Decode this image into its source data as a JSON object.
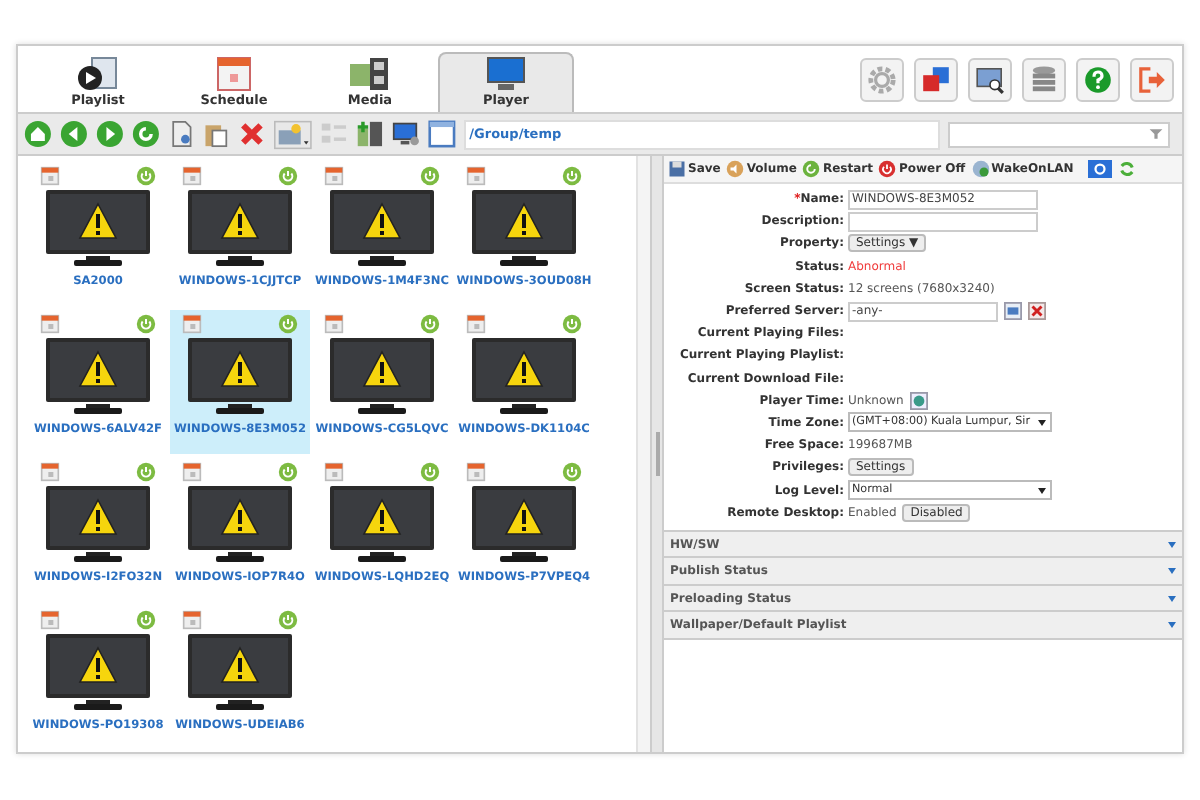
{
  "tabs": [
    {
      "label": "Playlist",
      "selected": false
    },
    {
      "label": "Schedule",
      "selected": false
    },
    {
      "label": "Media",
      "selected": false
    },
    {
      "label": "Player",
      "selected": true
    }
  ],
  "required_mark": "*",
  "path": "/Group/temp",
  "players": [
    {
      "name": "SA2000",
      "selected": false
    },
    {
      "name": "WINDOWS-1CJJTCP",
      "selected": false
    },
    {
      "name": "WINDOWS-1M4F3NC",
      "selected": false
    },
    {
      "name": "WINDOWS-3OUD08H",
      "selected": false
    },
    {
      "name": "WINDOWS-6ALV42F",
      "selected": false
    },
    {
      "name": "WINDOWS-8E3M052",
      "selected": true
    },
    {
      "name": "WINDOWS-CG5LQVC",
      "selected": false
    },
    {
      "name": "WINDOWS-DK1104C",
      "selected": false
    },
    {
      "name": "WINDOWS-I2FO32N",
      "selected": false
    },
    {
      "name": "WINDOWS-IOP7R4O",
      "selected": false
    },
    {
      "name": "WINDOWS-LQHD2EQ",
      "selected": false
    },
    {
      "name": "WINDOWS-P7VPEQ4",
      "selected": false
    },
    {
      "name": "WINDOWS-PO19308",
      "selected": false
    },
    {
      "name": "WINDOWS-UDEIAB6",
      "selected": false
    }
  ],
  "actions": [
    {
      "label": "Save"
    },
    {
      "label": "Volume"
    },
    {
      "label": "Restart"
    },
    {
      "label": "Power Off"
    },
    {
      "label": "WakeOnLAN"
    }
  ],
  "form": [
    {
      "label": "Name:",
      "required": true,
      "kind": "input",
      "value": "WINDOWS-8E3M052"
    },
    {
      "label": "Description:",
      "required": false,
      "kind": "input"
    },
    {
      "label": "Property:",
      "required": false,
      "kind": "menu",
      "value": "Settings ▼"
    },
    {
      "label": "Status:",
      "required": false,
      "kind": "alert",
      "value": "Abnormal"
    },
    {
      "label": "Screen Status:",
      "required": false,
      "kind": "text",
      "value": "12 screens (7680x3240)"
    },
    {
      "label": "Preferred Server:",
      "required": false,
      "kind": "server",
      "value": "-any-"
    },
    {
      "label": "Current Playing Files:",
      "required": false,
      "kind": "text"
    },
    {
      "label": "Current Playing Playlist:",
      "required": false,
      "kind": "text"
    },
    {
      "label": "Current Download File:",
      "required": false,
      "kind": "text"
    },
    {
      "label": "Player Time:",
      "required": false,
      "kind": "time",
      "value": "Unknown"
    },
    {
      "label": "Time Zone:",
      "required": false,
      "kind": "select",
      "value": "(GMT+08:00) Kuala Lumpur, Sir"
    },
    {
      "label": "Free Space:",
      "required": false,
      "kind": "text",
      "value": "199687MB"
    },
    {
      "label": "Privileges:",
      "required": false,
      "kind": "menu",
      "value": "Settings"
    },
    {
      "label": "Log Level:",
      "required": false,
      "kind": "select",
      "value": "Normal"
    },
    {
      "label": "Remote Desktop:",
      "required": false,
      "kind": "remote",
      "value": "Enabled",
      "button": "Disabled"
    }
  ],
  "sections": [
    {
      "title": "HW/SW",
      "expanded": false
    },
    {
      "title": "Publish Status",
      "expanded": false
    },
    {
      "title": "Preloading Status",
      "expanded": false
    },
    {
      "title": "Wallpaper/Default Playlist",
      "expanded": false
    }
  ]
}
